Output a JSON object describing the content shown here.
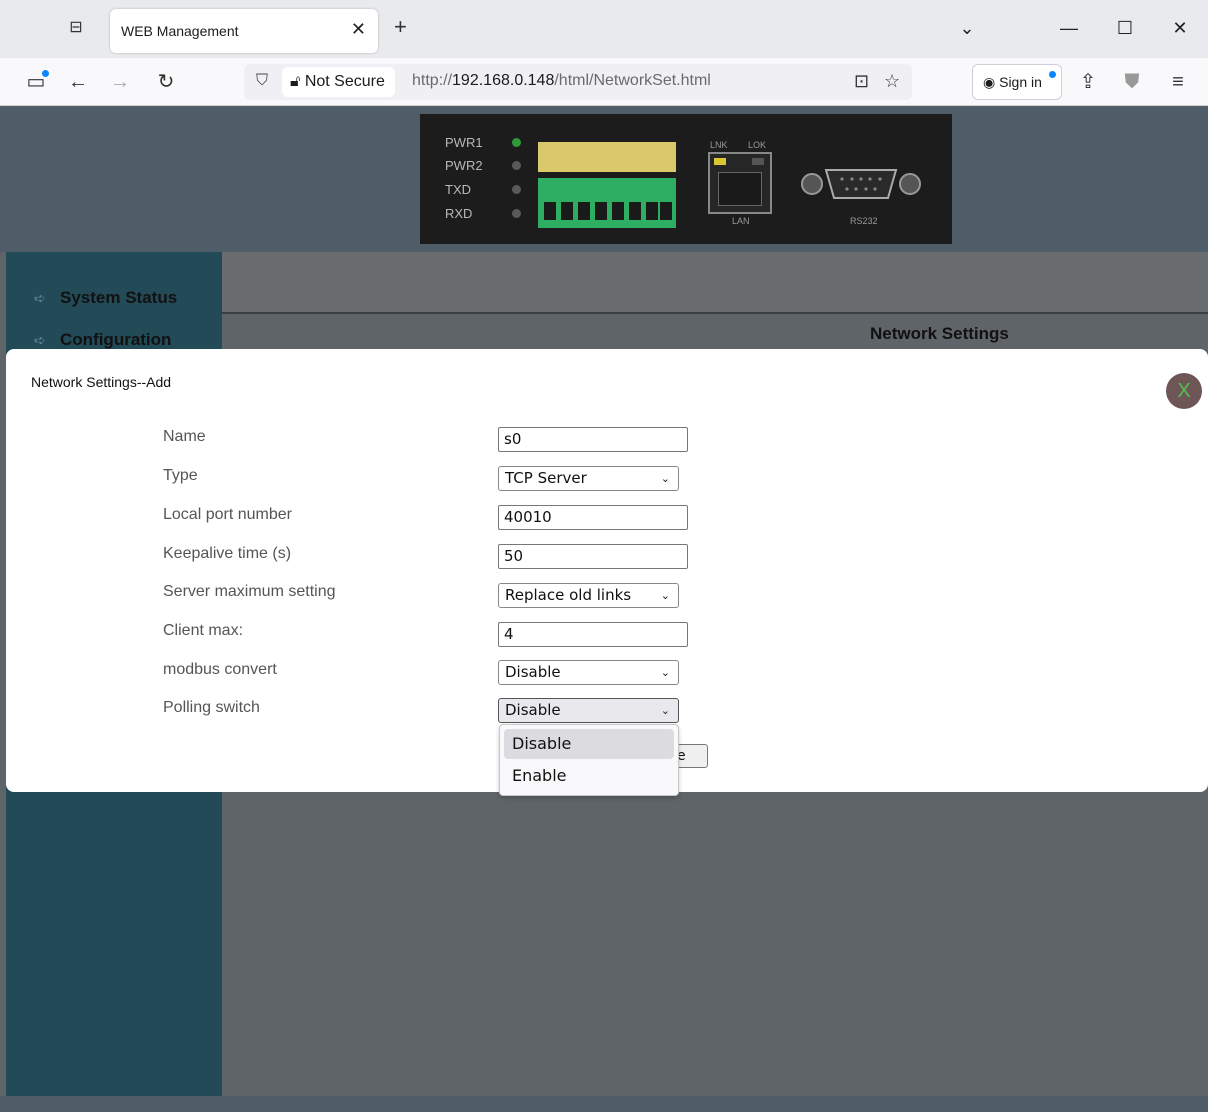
{
  "browser": {
    "tab_title": "WEB Management",
    "tab_close": "✕",
    "new_tab": "+",
    "not_secure": "Not Secure",
    "url_prefix": "http://",
    "url_host": "192.168.0.148",
    "url_path": "/html/NetworkSet.html",
    "sign_in": "Sign in"
  },
  "device": {
    "leds": [
      "PWR1",
      "PWR2",
      "TXD",
      "RXD"
    ],
    "port_labels": {
      "lnk": "LNK",
      "lok": "LOK",
      "lan": "LAN",
      "rs232": "RS232"
    }
  },
  "sidebar": {
    "items": [
      {
        "label": "System Status"
      },
      {
        "label": "Configuration"
      }
    ]
  },
  "main": {
    "title": "Network Settings"
  },
  "modal": {
    "title": "Network Settings--Add",
    "close": "X",
    "fields": {
      "name": {
        "label": "Name",
        "value": "s0"
      },
      "type": {
        "label": "Type",
        "value": "TCP Server"
      },
      "local_port": {
        "label": "Local port number",
        "value": "40010"
      },
      "keepalive": {
        "label": "Keepalive time (s)",
        "value": "50"
      },
      "server_max": {
        "label": "Server maximum setting",
        "value": "Replace old links"
      },
      "client_max": {
        "label": "Client max:",
        "value": "4"
      },
      "modbus": {
        "label": "modbus convert",
        "value": "Disable"
      },
      "polling": {
        "label": "Polling switch",
        "value": "Disable"
      }
    },
    "save_button_partial": "e",
    "dropdown_options": [
      "Disable",
      "Enable"
    ]
  },
  "colors": {
    "sidebar_bg": "#234a57",
    "header_bg": "#4f5d69",
    "close_button_bg": "#6e5656",
    "close_button_fg": "#4ec24e"
  }
}
